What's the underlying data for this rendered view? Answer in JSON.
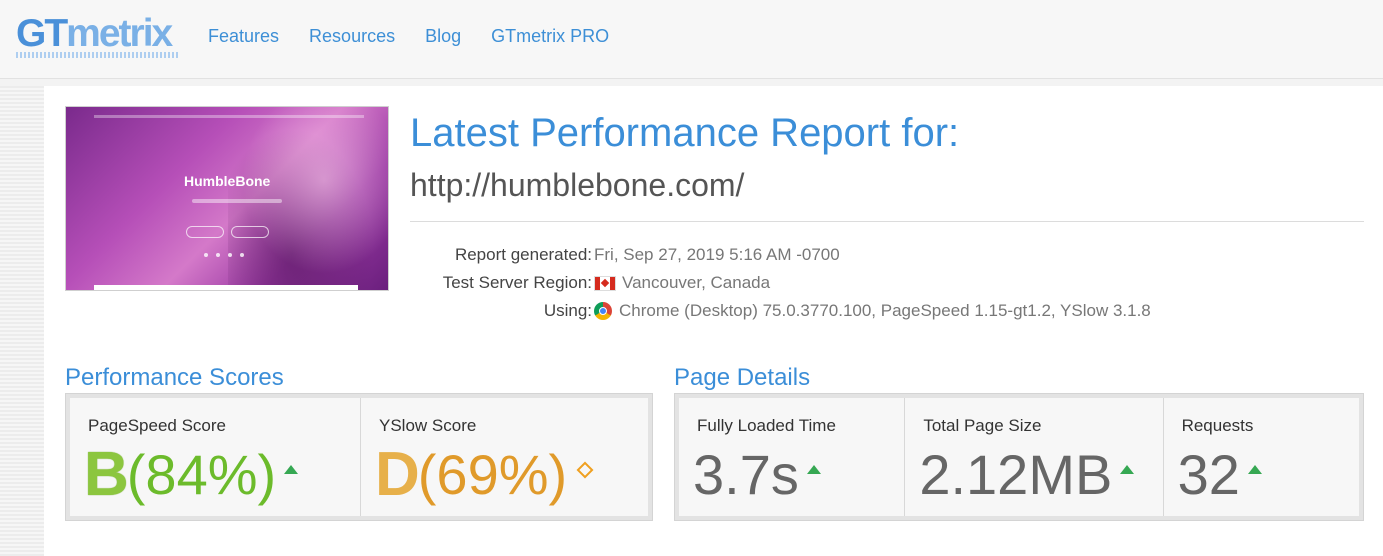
{
  "header": {
    "logo_gt": "GT",
    "logo_metrix": "metrix",
    "nav": [
      "Features",
      "Resources",
      "Blog",
      "GTmetrix PRO"
    ]
  },
  "thumbnail": {
    "site_name": "HumbleBone"
  },
  "report": {
    "title": "Latest Performance Report for:",
    "url": "http://humblebone.com/",
    "meta": [
      {
        "label": "Report generated:",
        "value": "Fri, Sep 27, 2019 5:16 AM -0700",
        "icon": ""
      },
      {
        "label": "Test Server Region:",
        "value": "Vancouver, Canada",
        "icon": "canada-flag-icon"
      },
      {
        "label": "Using:",
        "value": "Chrome (Desktop) 75.0.3770.100, PageSpeed 1.15-gt1.2, YSlow 3.1.8",
        "icon": "chrome-icon"
      }
    ]
  },
  "performance": {
    "title": "Performance Scores",
    "pagespeed": {
      "label": "PageSpeed Score",
      "grade": "B",
      "percent": "(84%)",
      "trend": "up"
    },
    "yslow": {
      "label": "YSlow Score",
      "grade": "D",
      "percent": "(69%)",
      "trend": "neutral"
    }
  },
  "details": {
    "title": "Page Details",
    "fully_loaded": {
      "label": "Fully Loaded Time",
      "value": "3.7s"
    },
    "page_size": {
      "label": "Total Page Size",
      "value": "2.12MB"
    },
    "requests": {
      "label": "Requests",
      "value": "32"
    }
  },
  "colors": {
    "brand_blue": "#3b8ed8",
    "grade_b": "#8cc63f",
    "grade_d": "#e7b04a",
    "trend_up": "#36a853",
    "trend_neutral": "#f0a020"
  }
}
